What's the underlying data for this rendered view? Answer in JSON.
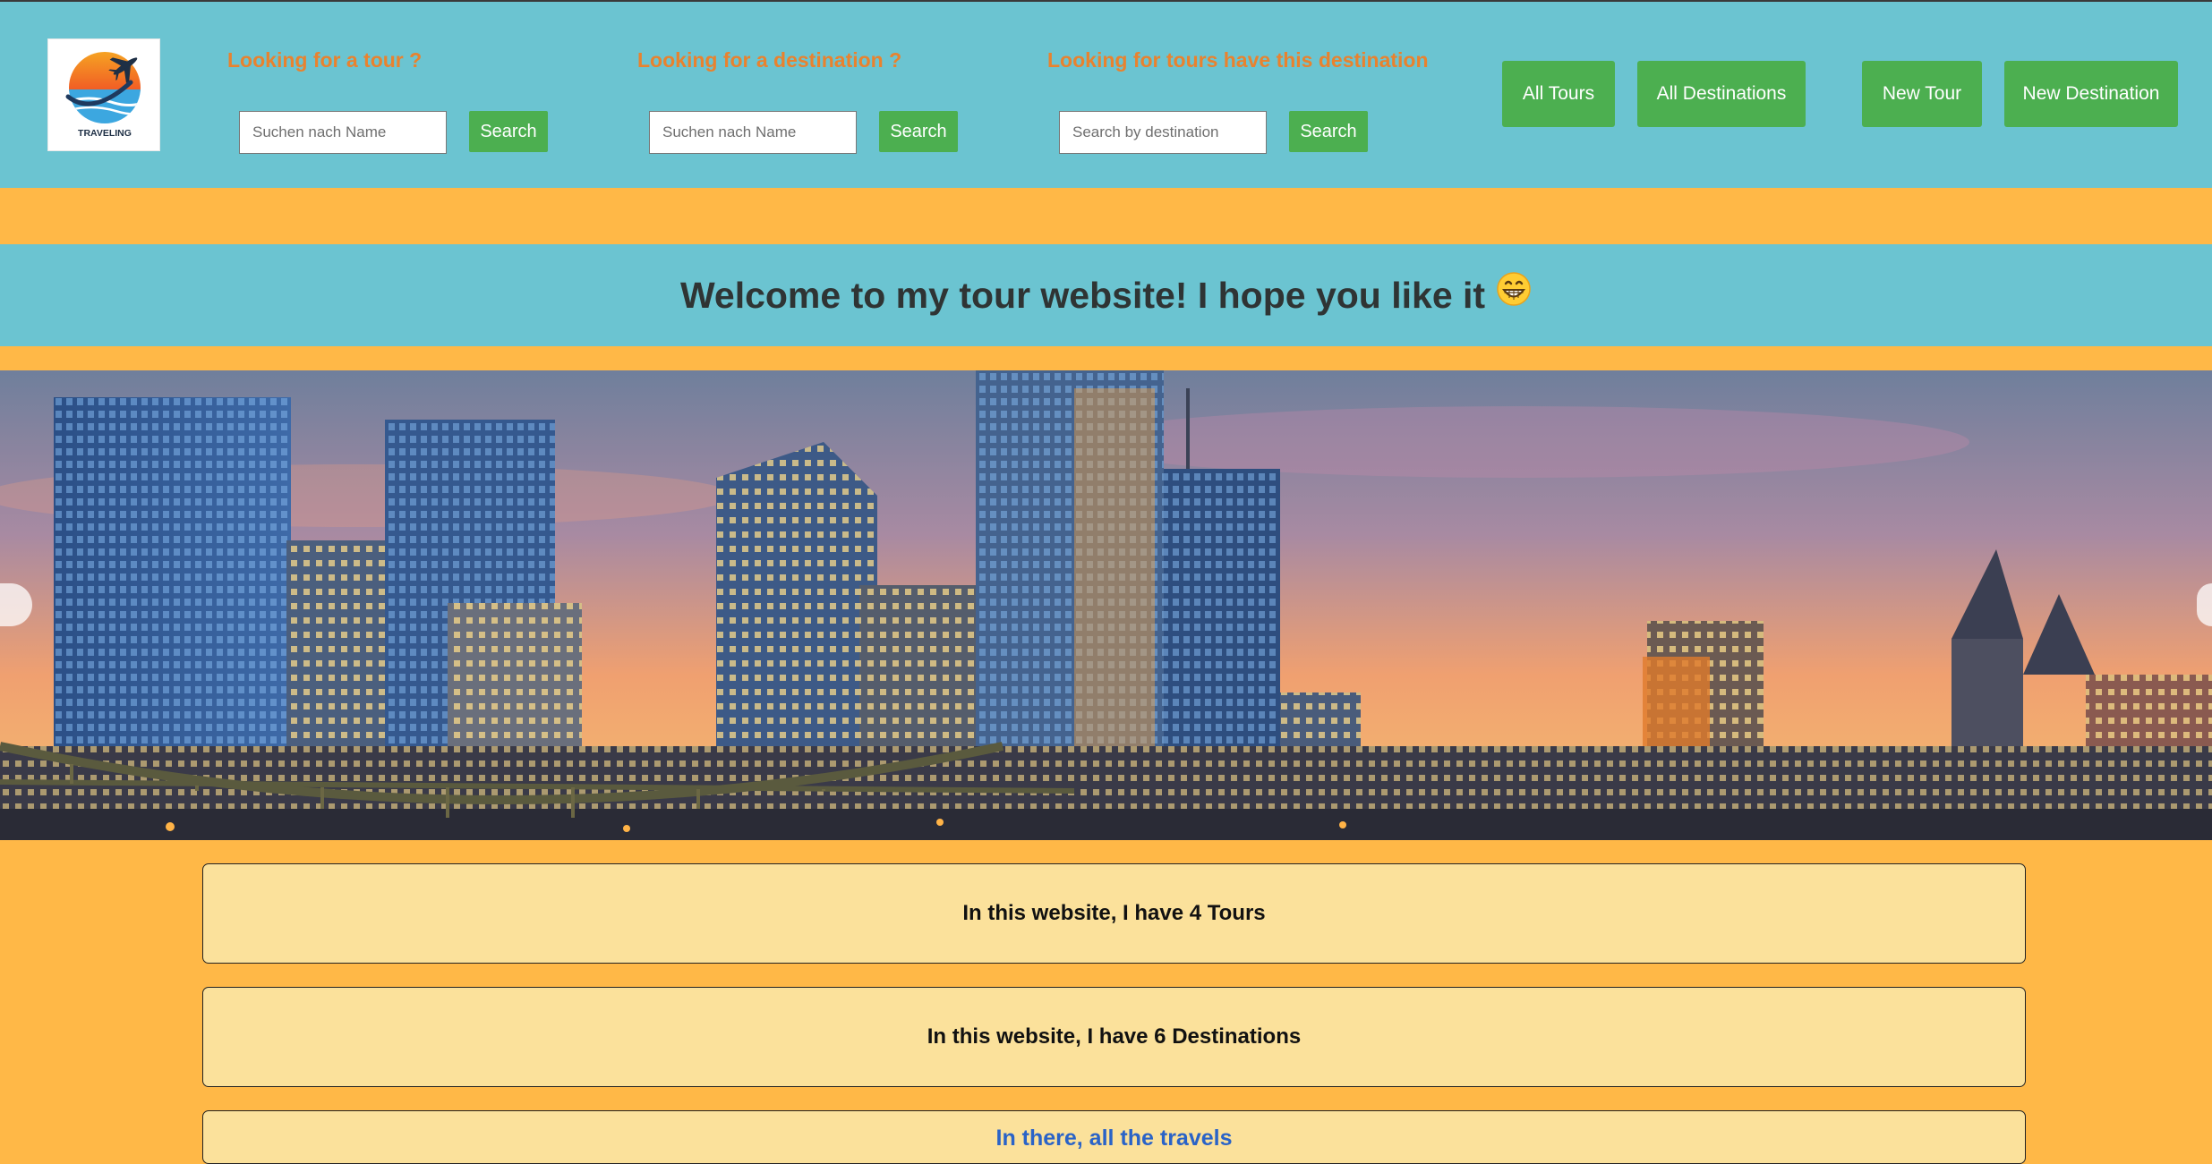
{
  "brand": {
    "logo_text": "TRAVELING"
  },
  "search_tour": {
    "heading": "Looking for a tour ?",
    "placeholder": "Suchen nach Name",
    "value": "",
    "button": "Search"
  },
  "search_destination": {
    "heading": "Looking for a destination ?",
    "placeholder": "Suchen nach Name",
    "value": "",
    "button": "Search"
  },
  "search_by_destination": {
    "heading": "Looking for tours have this destination",
    "placeholder": "Search by destination",
    "value": "",
    "button": "Search"
  },
  "nav": {
    "all_tours": "All Tours",
    "all_destinations": "All Destinations",
    "new_tour": "New Tour",
    "new_destination": "New Destination"
  },
  "welcome": {
    "text": "Welcome to my tour website! I hope you like it",
    "emoji": "grinning-face-icon"
  },
  "hero": {
    "image": "city-skyline-at-sunset"
  },
  "stats": {
    "tours": "In this website, I have 4 Tours",
    "destinations": "In this website, I have 6 Destinations",
    "link": "In there, all the travels"
  },
  "colors": {
    "header_bg": "#6BC4D1",
    "page_bg": "#FFB847",
    "heading_orange": "#E9822E",
    "button_green": "#4CAF50",
    "card_bg": "#FBE19B",
    "link_blue": "#2A63C7"
  }
}
